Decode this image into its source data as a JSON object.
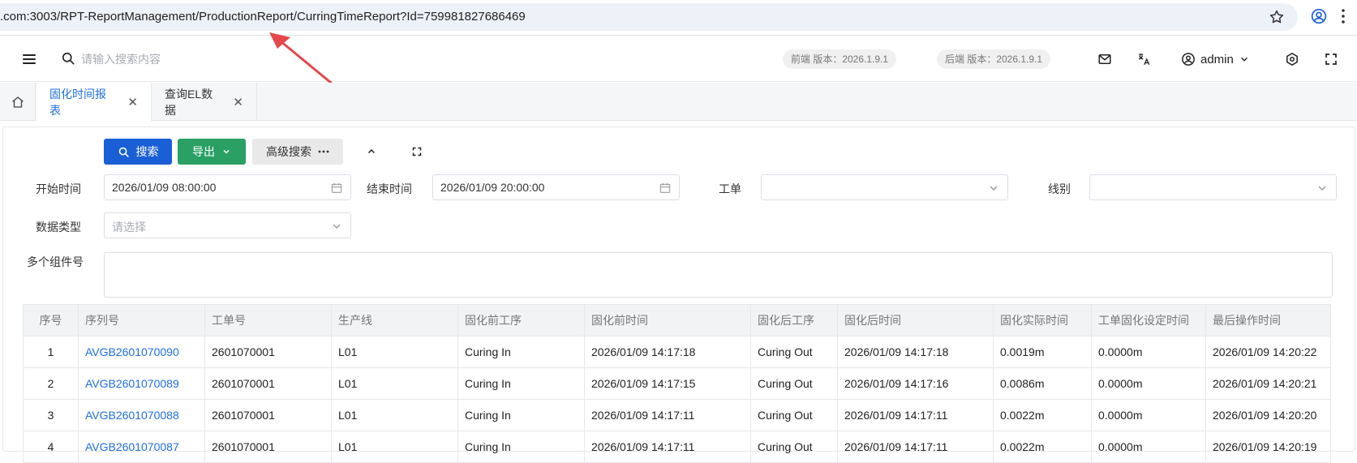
{
  "browser": {
    "url": ".com:3003/RPT-ReportManagement/ProductionReport/CurringTimeReport?Id=759981827686469"
  },
  "header": {
    "search_placeholder": "请输入搜索内容",
    "frontend_version": "前端 版本：2026.1.9.1",
    "backend_version": "后端 版本：2026.1.9.1",
    "username": "admin"
  },
  "tabs": [
    {
      "label": "固化时间报表",
      "active": true
    },
    {
      "label": "查询EL数据",
      "active": false
    }
  ],
  "toolbar": {
    "search_label": "搜索",
    "export_label": "导出",
    "advanced_label": "高级搜索"
  },
  "form": {
    "start_time_label": "开始时间",
    "start_time_value": "2026/01/09 08:00:00",
    "end_time_label": "结束时间",
    "end_time_value": "2026/01/09 20:00:00",
    "work_order_label": "工单",
    "line_label": "线别",
    "data_type_label": "数据类型",
    "data_type_placeholder": "请选择",
    "multi_component_label": "多个组件号"
  },
  "table": {
    "columns": [
      "序号",
      "序列号",
      "工单号",
      "生产线",
      "固化前工序",
      "固化前时间",
      "固化后工序",
      "固化后时间",
      "固化实际时间",
      "工单固化设定时间",
      "最后操作时间"
    ],
    "rows": [
      [
        "1",
        "AVGB2601070090",
        "2601070001",
        "L01",
        "Curing In",
        "2026/01/09 14:17:18",
        "Curing Out",
        "2026/01/09 14:17:18",
        "0.0019m",
        "0.0000m",
        "2026/01/09 14:20:22"
      ],
      [
        "2",
        "AVGB2601070089",
        "2601070001",
        "L01",
        "Curing In",
        "2026/01/09 14:17:15",
        "Curing Out",
        "2026/01/09 14:17:16",
        "0.0086m",
        "0.0000m",
        "2026/01/09 14:20:21"
      ],
      [
        "3",
        "AVGB2601070088",
        "2601070001",
        "L01",
        "Curing In",
        "2026/01/09 14:17:11",
        "Curing Out",
        "2026/01/09 14:17:11",
        "0.0022m",
        "0.0000m",
        "2026/01/09 14:20:20"
      ],
      [
        "4",
        "AVGB2601070087",
        "2601070001",
        "L01",
        "Curing In",
        "2026/01/09 14:17:11",
        "Curing Out",
        "2026/01/09 14:17:11",
        "0.0022m",
        "0.0000m",
        "2026/01/09 14:20:19"
      ]
    ]
  },
  "colors": {
    "primary": "#1a5fd6",
    "export": "#2aa065",
    "link": "#1f6fe0",
    "annotation_arrow": "#e5484d"
  }
}
